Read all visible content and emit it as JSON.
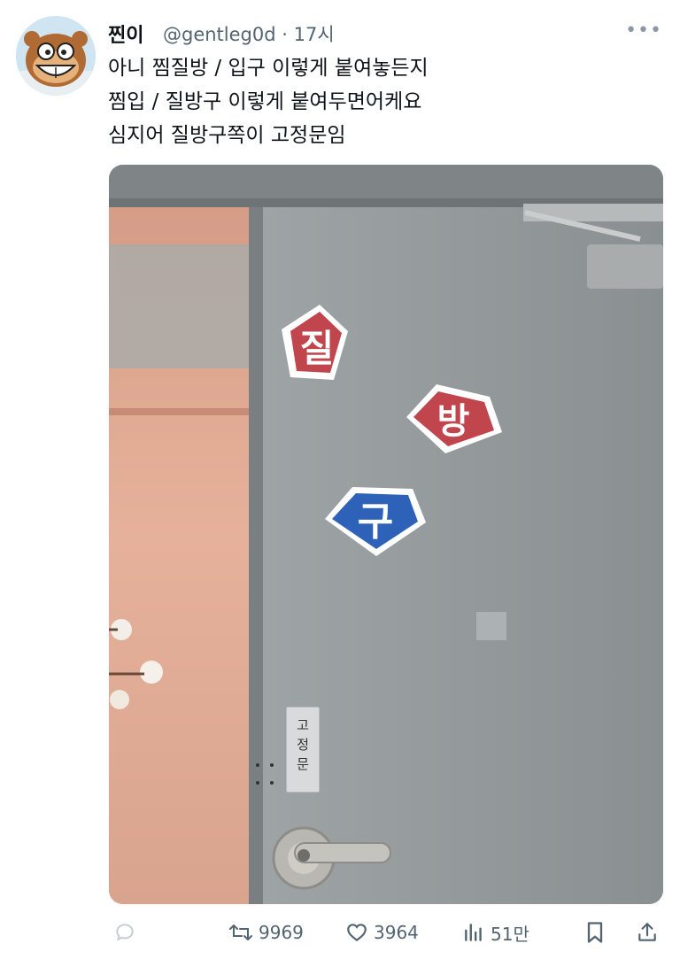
{
  "user": {
    "display_name": "찐이",
    "handle": "@gentleg0d",
    "separator": "·",
    "time": "17시"
  },
  "tweet": {
    "lines": [
      "아니 찜질방 / 입구 이렇게 붙여놓든지",
      "찜입 / 질방구 이렇게 붙여두면어케요",
      "심지어 질방구쪽이 고정문임"
    ]
  },
  "photo": {
    "signs": [
      {
        "char": "질",
        "color": "#c0454c"
      },
      {
        "char": "방",
        "color": "#c0454c"
      },
      {
        "char": "구",
        "color": "#2e62b8"
      }
    ],
    "plate_chars": [
      "고",
      "정",
      "문"
    ]
  },
  "actions": {
    "reply_icon": "comment-icon",
    "retweet_count": "9969",
    "like_count": "3964",
    "views_count": "51만",
    "bookmark_icon": "bookmark-icon",
    "share_icon": "share-icon"
  },
  "colors": {
    "text": "#0f1419",
    "muted": "#536471",
    "sign_red": "#c0454c",
    "sign_blue": "#2e62b8"
  }
}
